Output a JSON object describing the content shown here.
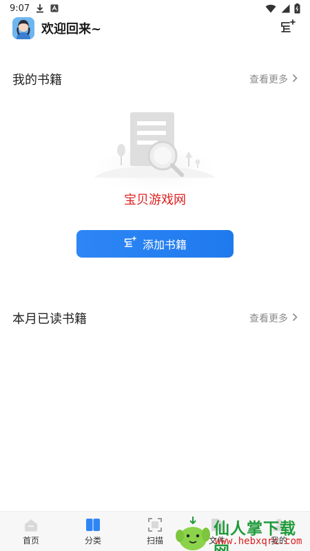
{
  "status_bar": {
    "time": "9:07"
  },
  "header": {
    "welcome": "欢迎回来~"
  },
  "my_books": {
    "title": "我的书籍",
    "see_more": "查看更多"
  },
  "empty_state": {
    "watermark_text": "宝贝游戏网"
  },
  "add_button": {
    "label": "添加书籍"
  },
  "monthly_read": {
    "title": "本月已读书籍",
    "see_more": "查看更多"
  },
  "bottom_nav": {
    "items": [
      {
        "label": "首页",
        "icon": "home-icon"
      },
      {
        "label": "分类",
        "icon": "book-icon"
      },
      {
        "label": "扫描",
        "icon": "scan-icon"
      },
      {
        "label": "文件",
        "icon": "file-icon"
      },
      {
        "label": "我的",
        "icon": "user-icon"
      }
    ]
  },
  "watermark": {
    "title": "仙人掌下载网",
    "url": "www.hebxqrc.com"
  },
  "colors": {
    "accent": "#2e86f5",
    "watermark_red": "#e02020",
    "watermark_green": "#1e9a3a"
  }
}
